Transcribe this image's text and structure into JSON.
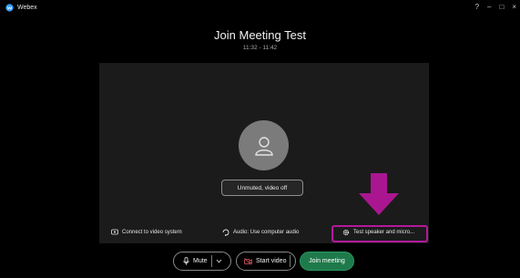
{
  "window": {
    "app_name": "Webex",
    "controls": {
      "help": "?",
      "minimize": "–",
      "maximize": "□",
      "close": "×"
    }
  },
  "meeting": {
    "title": "Join Meeting Test",
    "time": "11:32 - 11:42"
  },
  "preview": {
    "status": "Unmuted, video off"
  },
  "options": {
    "video_system": "Connect to video system",
    "audio": "Audio: Use computer audio",
    "test": "Test speaker and micro..."
  },
  "controls": {
    "mute": "Mute",
    "start_video": "Start video",
    "join": "Join meeting"
  },
  "colors": {
    "background": "#000000",
    "preview": "#1b1b1b",
    "highlight": "#b3199b",
    "join": "#1e7a4a"
  },
  "icons": [
    "webex-logo-icon",
    "help-icon",
    "person-icon",
    "video-system-icon",
    "audio-icon",
    "gear-icon",
    "microphone-icon",
    "video-off-icon",
    "chevron-down-icon",
    "arrow-down-annotation"
  ]
}
